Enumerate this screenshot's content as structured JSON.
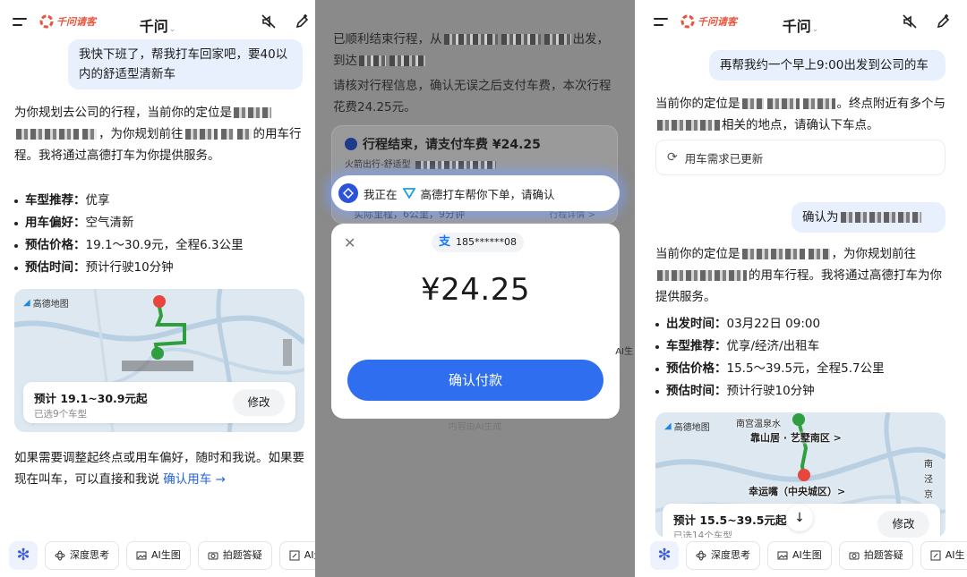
{
  "brand_name": "千问请客",
  "app_title": "千问",
  "title_chevron": "⌄",
  "bottom_bar": [
    {
      "label": "深度思考",
      "icon": "atom-icon"
    },
    {
      "label": "AI生图",
      "icon": "image-icon"
    },
    {
      "label": "拍题答疑",
      "icon": "camera-icon"
    },
    {
      "label": "AI生",
      "icon": "pen-icon"
    }
  ],
  "bottom_star": "✻",
  "panel1": {
    "user_msg": "我快下班了，帮我打车回家吧，要40以内的舒适型清新车",
    "reply_a": "为你规划去公司的行程，当前你的定位是",
    "reply_b": "，为你规划前往",
    "reply_c": "的用车行程。我将通过高德打车为你提供服务。",
    "bullets": [
      {
        "k": "车型推荐：",
        "v": "优享"
      },
      {
        "k": "用车偏好：",
        "v": "空气清新"
      },
      {
        "k": "预估价格：",
        "v": "19.1～30.9元，全程6.3公里"
      },
      {
        "k": "预估时间：",
        "v": "预计行驶10分钟"
      }
    ],
    "map_logo": "高德地图",
    "estimate": "预计 19.1~30.9元起",
    "car_types": "已选9个车型",
    "edit": "修改",
    "footer_a": "如果需要调整起终点或用车偏好，随时和我说。如果要现在叫车，可以直接和我说",
    "confirm_link": "确认用车 →"
  },
  "panel2": {
    "text1_a": "已顺利结束行程，从",
    "text1_b": "出发，到达",
    "text2": "请核对行程信息，确认无误之后支付车费，本次行程花费24.25元。",
    "card_title": "行程结束，请支付车费 ¥24.25",
    "card_sub": "火箭出行-舒适型",
    "card_dist": "实际里程，6公里，9分钟",
    "card_detail": "行程详情 >",
    "pill_text": "我正在",
    "pill_text2": "高德打车帮你下单，请确认",
    "close": "✕",
    "alipay": "支",
    "account": "185******08",
    "amount": "¥24.25",
    "pay_button": "确认付款",
    "footer": "内容由AI生成",
    "side": "AI生"
  },
  "panel3": {
    "user_msg1": "再帮我约一个早上9:00出发到公司的车",
    "reply1_a": "当前你的定位是",
    "reply1_b": "。终点附近有多个与",
    "reply1_c": "相关的地点，请确认下车点。",
    "status": "用车需求已更新",
    "user_msg2": "确认为",
    "reply2_a": "当前你的定位是",
    "reply2_b": "，为你规划前往",
    "reply2_c": "的用车行程。我将通过高德打车为你提供服务。",
    "bullets": [
      {
        "k": "出发时间：",
        "v": "03月22日 09:00"
      },
      {
        "k": "车型推荐：",
        "v": "优享/经济/出租车"
      },
      {
        "k": "预估价格：",
        "v": "15.5～39.5元，全程5.7公里"
      },
      {
        "k": "预估时间：",
        "v": "预计行驶10分钟"
      }
    ],
    "map_logo": "高德地图",
    "map_tag1": "靠山居 · 艺墅南区 >",
    "map_tag2": "幸运嘴（中央城区）>",
    "map_tag3": "南宫温泉水",
    "map_side": "南 泾 京 开",
    "estimate": "预计 15.5~39.5元起",
    "car_types": "已选14个车型",
    "edit": "修改",
    "down_arrow": "↓"
  },
  "colors": {
    "accent": "#2f6fef",
    "brand": "#e8553e",
    "route": "#2e9e3e",
    "bubble": "#e8f0fd"
  }
}
